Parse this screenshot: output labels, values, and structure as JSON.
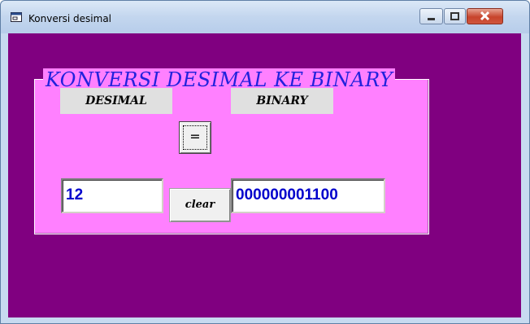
{
  "window": {
    "title": "Konversi desimal"
  },
  "form": {
    "frame_title": "KONVERSI DESIMAL KE BINARY",
    "desimal_label": "DESIMAL",
    "binary_label": "BINARY",
    "equals_button": "=",
    "desimal_value": "12",
    "binary_value": "000000001100",
    "clear_button": "clear"
  },
  "colors": {
    "background": "#800080",
    "frame": "#ff80ff",
    "title_text": "#2222dd",
    "value_text": "#0000cc"
  },
  "icons": {
    "app": "vb-form-icon",
    "minimize": "minimize-icon",
    "maximize": "maximize-icon",
    "close": "close-icon"
  }
}
